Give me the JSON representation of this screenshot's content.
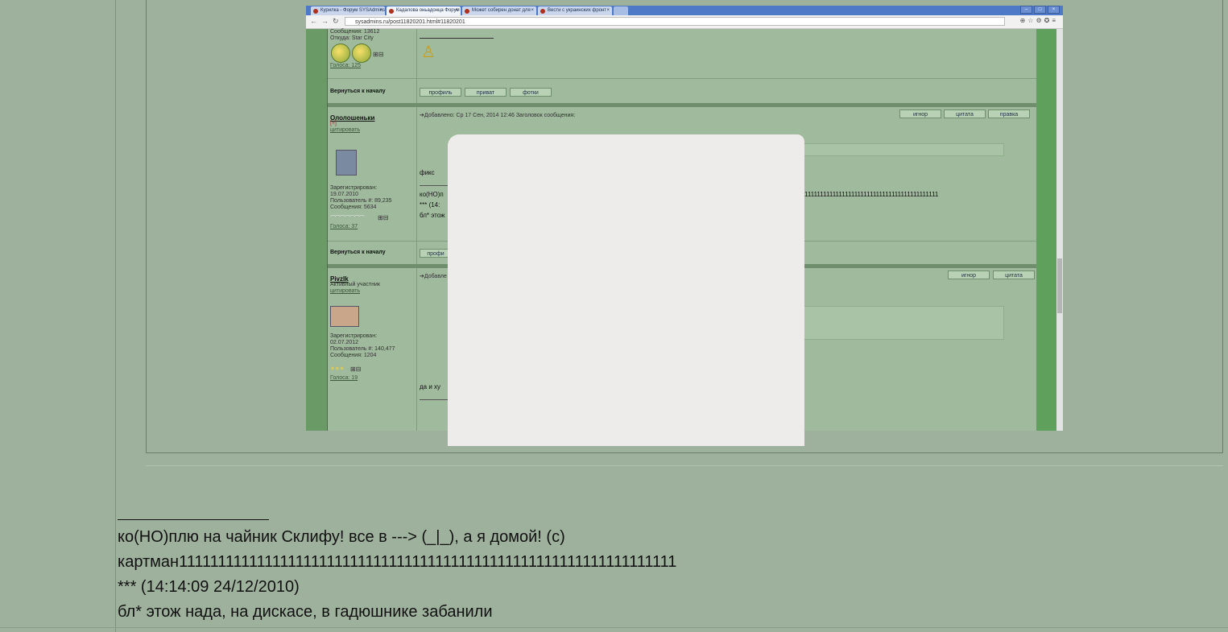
{
  "embedded_screenshot": {
    "tabs": [
      {
        "label": "Курилка - Форум SYSAdmins"
      },
      {
        "label": "Кадалова оньадонца Форум"
      },
      {
        "label": "Может собирен донат для"
      },
      {
        "label": "Вести с украинских фронт"
      }
    ],
    "address": "sysadmins.ru/post11820201.html#11820201",
    "posts": [
      {
        "meta_messages": "Сообщения: 13612",
        "meta_from": "Откуда: Star City",
        "votes": "Голоса: 125",
        "back_to_top": "Вернуться к началу",
        "buttons": [
          "профиль",
          "приват",
          "фотки"
        ]
      },
      {
        "author": "Ололошеньки",
        "tag": "[+]",
        "quote_link": "цитировать",
        "added": "Добавлено: Ср 17 Сен, 2014 12:46    Заголовок сообщения:",
        "registered_label": "Зарегистрирован:",
        "registered_date": "19.07.2010",
        "user_no": "Пользователь #: 89,235",
        "messages": "Сообщения: 5634",
        "votes": "Голоса: 37",
        "action_buttons": [
          "игнор",
          "цитата",
          "правка"
        ],
        "body_visible": "фикс",
        "sig_line1": "ко(НО)п",
        "sig_line2": "*** (14:",
        "sig_line3": "бл* этож",
        "sig_tail": "1111111111111111111111111111111111111111111",
        "back_to_top": "Вернуться к началу",
        "profile_btn": "профи"
      },
      {
        "author": "PivzIk",
        "rank": "Активный участник",
        "quote_link": "цитировать",
        "added": "Добавле",
        "registered_label": "Зарегистрирован:",
        "registered_date": "02.07.2012",
        "user_no": "Пользователь #: 140,477",
        "messages": "Сообщения: 1204",
        "votes": "Голоса: 19",
        "action_buttons": [
          "игнор",
          "цитата"
        ],
        "body_visible": "да и ху"
      }
    ]
  },
  "signature": {
    "line1": "ко(НО)плю на чайник Склифу! все в ---> (_|_), а я домой! (с)",
    "line2": "картман1111111111111111111111111111111111111111111111111111111111111111",
    "line3": "*** (14:14:09 24/12/2010)",
    "line4": "бл* этож нада, на дискасе, в гадюшнике забанили"
  }
}
